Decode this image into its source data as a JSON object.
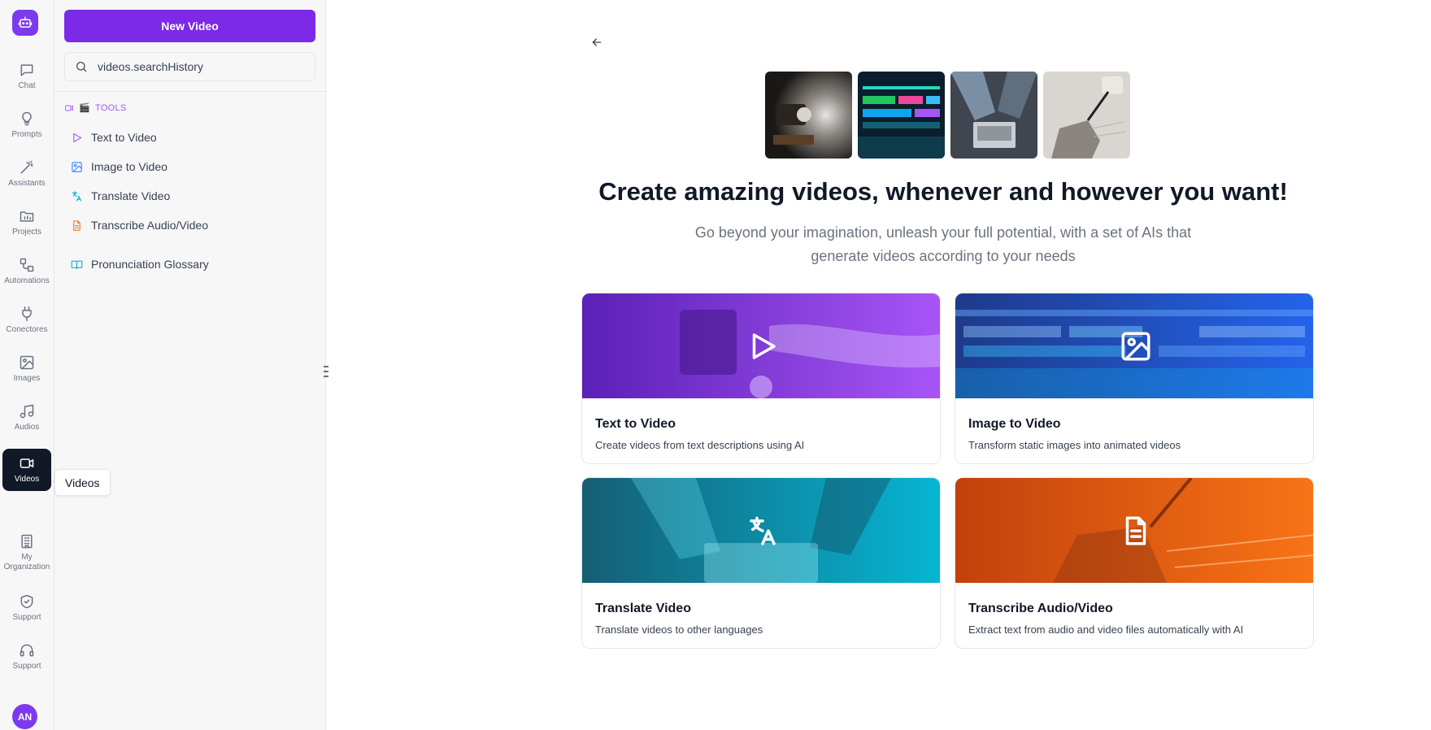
{
  "rail": {
    "items": [
      {
        "label": "Chat",
        "icon": "chat-icon"
      },
      {
        "label": "Prompts",
        "icon": "lightbulb-icon"
      },
      {
        "label": "Assistants",
        "icon": "magic-wand-icon"
      },
      {
        "label": "Projects",
        "icon": "folder-icon"
      },
      {
        "label": "Automations",
        "icon": "workflow-icon"
      },
      {
        "label": "Conectores",
        "icon": "plug-icon"
      },
      {
        "label": "Images",
        "icon": "image-icon"
      },
      {
        "label": "Audios",
        "icon": "music-icon"
      },
      {
        "label": "Videos",
        "icon": "video-icon",
        "active": true
      },
      {
        "label": "My Organization",
        "icon": "building-icon"
      },
      {
        "label": "Support",
        "icon": "shield-icon"
      },
      {
        "label": "Support",
        "icon": "headphones-icon"
      }
    ],
    "avatar_initials": "AN",
    "tooltip": "Videos"
  },
  "panel": {
    "new_button": "New Video",
    "search_placeholder": "videos.searchHistory",
    "section_label": "TOOLS",
    "items": [
      {
        "label": "Text to Video",
        "icon": "play-icon",
        "color": "#a855f7"
      },
      {
        "label": "Image to Video",
        "icon": "image-icon",
        "color": "#3b82f6"
      },
      {
        "label": "Translate Video",
        "icon": "translate-icon",
        "color": "#06b6d4"
      },
      {
        "label": "Transcribe Audio/Video",
        "icon": "file-text-icon",
        "color": "#f97316"
      },
      {
        "label": "Pronunciation Glossary",
        "icon": "book-open-icon",
        "color": "#06b6d4"
      }
    ]
  },
  "main": {
    "title": "Create amazing videos, whenever and however you want!",
    "subtitle": "Go beyond your imagination, unleash your full potential, with a set of AIs that generate videos according to your needs",
    "cards": [
      {
        "title": "Text to Video",
        "description": "Create videos from text descriptions using AI",
        "icon": "play-icon",
        "color": "#7c3aed"
      },
      {
        "title": "Image to Video",
        "description": "Transform static images into animated videos",
        "icon": "image-icon",
        "color": "#2563eb"
      },
      {
        "title": "Translate Video",
        "description": "Translate videos to other languages",
        "icon": "translate-icon",
        "color": "#0891b2"
      },
      {
        "title": "Transcribe Audio/Video",
        "description": "Extract text from audio and video files automatically with AI",
        "icon": "file-text-icon",
        "color": "#ea580c"
      }
    ]
  }
}
